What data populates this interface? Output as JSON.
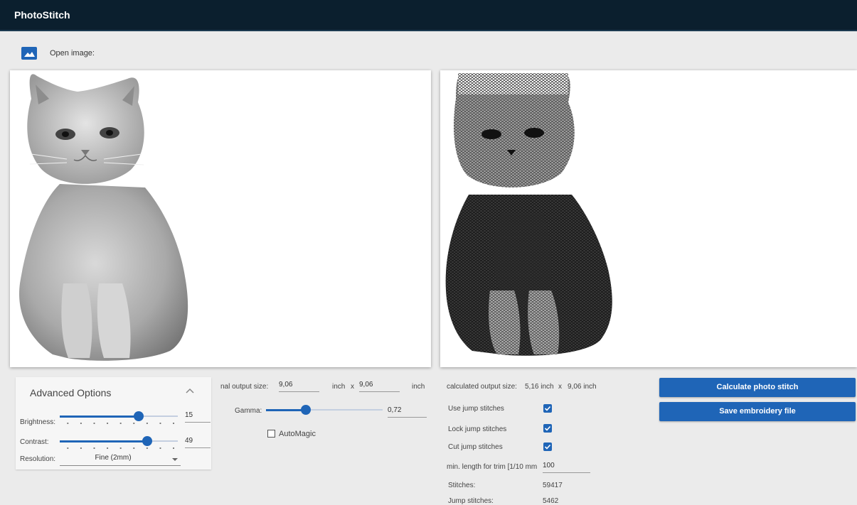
{
  "app": {
    "title": "PhotoStitch"
  },
  "toolbar": {
    "open_icon": "image-icon",
    "open_label": "Open image:"
  },
  "advanced": {
    "title": "Advanced Options",
    "expanded": true,
    "brightness_label": "Brightness:",
    "brightness_value": "15",
    "brightness_fraction": 0.67,
    "contrast_label": "Contrast:",
    "contrast_value": "49",
    "contrast_fraction": 0.74,
    "resolution_label": "Resolution:",
    "resolution_value": "Fine (2mm)"
  },
  "output": {
    "size_label": "nal output size:",
    "width_value": "9,06",
    "width_unit": "inch",
    "times": "x",
    "height_value": "9,06",
    "height_unit": "inch",
    "gamma_label": "Gamma:",
    "gamma_value": "0,72",
    "gamma_fraction": 0.34,
    "automagic_label": "AutoMagic",
    "automagic_checked": false
  },
  "stitch": {
    "calculated_label": "calculated output size:",
    "calculated_width": "5,16 inch",
    "times": "x",
    "calculated_height": "9,06 inch",
    "use_jump_label": "Use jump stitches",
    "use_jump_checked": true,
    "lock_jump_label": "Lock jump stitches",
    "lock_jump_checked": true,
    "cut_jump_label": "Cut jump stitches",
    "cut_jump_checked": true,
    "min_length_label": "min. length for trim [1/10 mm",
    "min_length_value": "100",
    "stitches_label": "Stitches:",
    "stitches_value": "59417",
    "jump_stitches_label": "Jump stitches:",
    "jump_stitches_value": "5462"
  },
  "actions": {
    "calculate_label": "Calculate photo stitch",
    "save_label": "Save embroidery file"
  },
  "colors": {
    "topbar": "#0b1f2e",
    "accent": "#1f65b7",
    "background": "#ebebeb"
  }
}
